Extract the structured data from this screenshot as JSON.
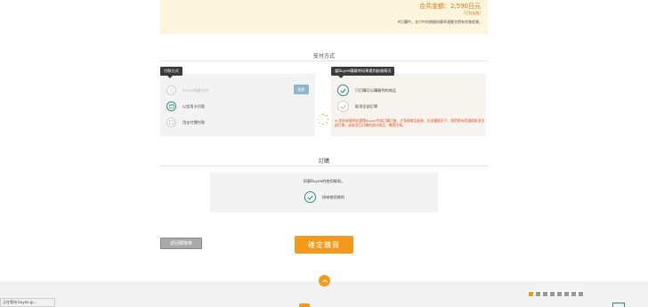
{
  "summary": {
    "total": "合共金額：2,590日元",
    "sub": "(已包括稅)",
    "note": "※訂購中，支付中的總額與匯率通匯兌價有些微差異。"
  },
  "payment": {
    "section_title": "支付方式",
    "tooltip": "付款方式",
    "apply_button": "變更",
    "options": [
      {
        "label": "buyee點數支付",
        "muted": true
      },
      {
        "label": "以信用卡付款",
        "muted": false
      },
      {
        "label": "用支付寶付款",
        "muted": false
      }
    ]
  },
  "stock": {
    "tooltip": "當Buyee購買時如果遇到缺貨情況",
    "options": [
      {
        "label": "只訂購可以購買到的商品"
      },
      {
        "label": "取消全部訂單"
      }
    ],
    "warning": "※ 如有缺貨時若選擇Buyee完成訂購之後，才發現商品缺貨，在這種情況下，我們將為您處理取消全部訂單，或取消已訂購的部分商品，敬請注意。"
  },
  "order": {
    "section_title": "訂購",
    "agree_text": "同意Buyee的使用條款。",
    "agree_label": "接納使用條約"
  },
  "buttons": {
    "back": "返回購物車",
    "confirm": "確定購買"
  },
  "footer": {
    "status": "正在等待 buyee.jp..."
  },
  "colors": {
    "accent": "#f39a1a",
    "check": "#2e8b7b",
    "warning": "#e0512a"
  }
}
